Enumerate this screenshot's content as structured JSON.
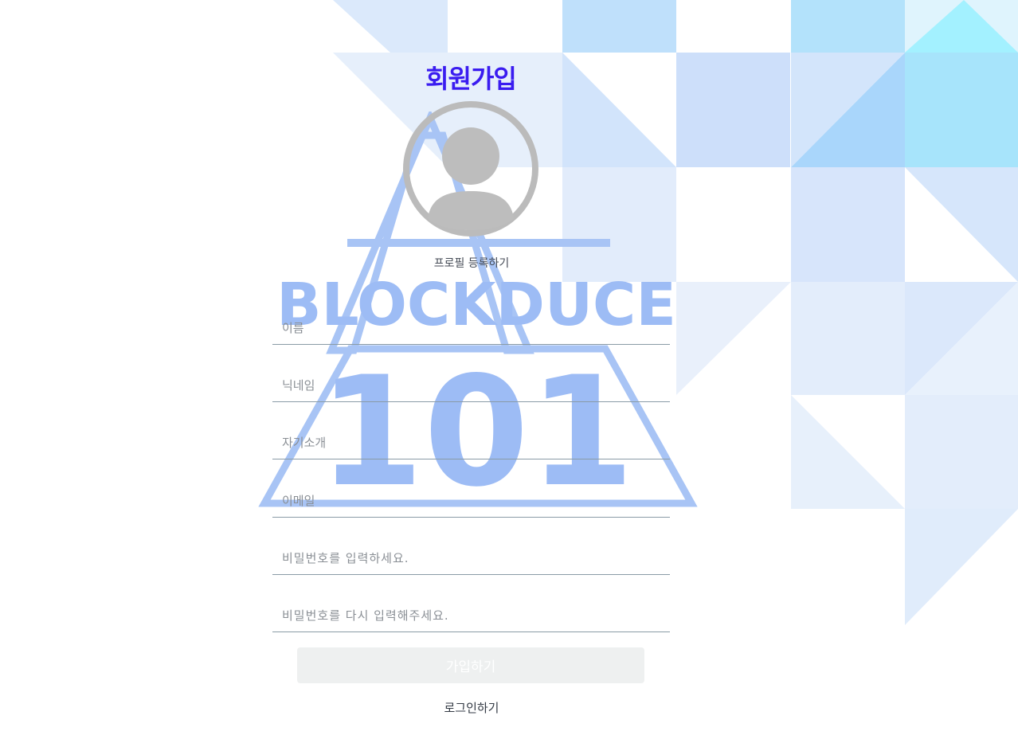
{
  "header": {
    "title": "회원가입"
  },
  "profile": {
    "register_label": "프로필 등록하기",
    "avatar_icon": "user-avatar-icon"
  },
  "form": {
    "name_placeholder": "이름",
    "nickname_placeholder": "닉네임",
    "bio_placeholder": "자기소개",
    "email_placeholder": "이메일",
    "password_placeholder": "비밀번호를 입력하세요.",
    "password_confirm_placeholder": "비밀번호를 다시 입력해주세요.",
    "submit_label": "가입하기",
    "login_link_label": "로그인하기"
  },
  "watermark": {
    "brand_text": "BLOCKDUCE",
    "number_text": "101"
  },
  "colors": {
    "title": "#3a1cf0",
    "watermark": "#9dbcf5",
    "field_underline": "#8a9ba6",
    "button_disabled": "#eef0f0"
  }
}
